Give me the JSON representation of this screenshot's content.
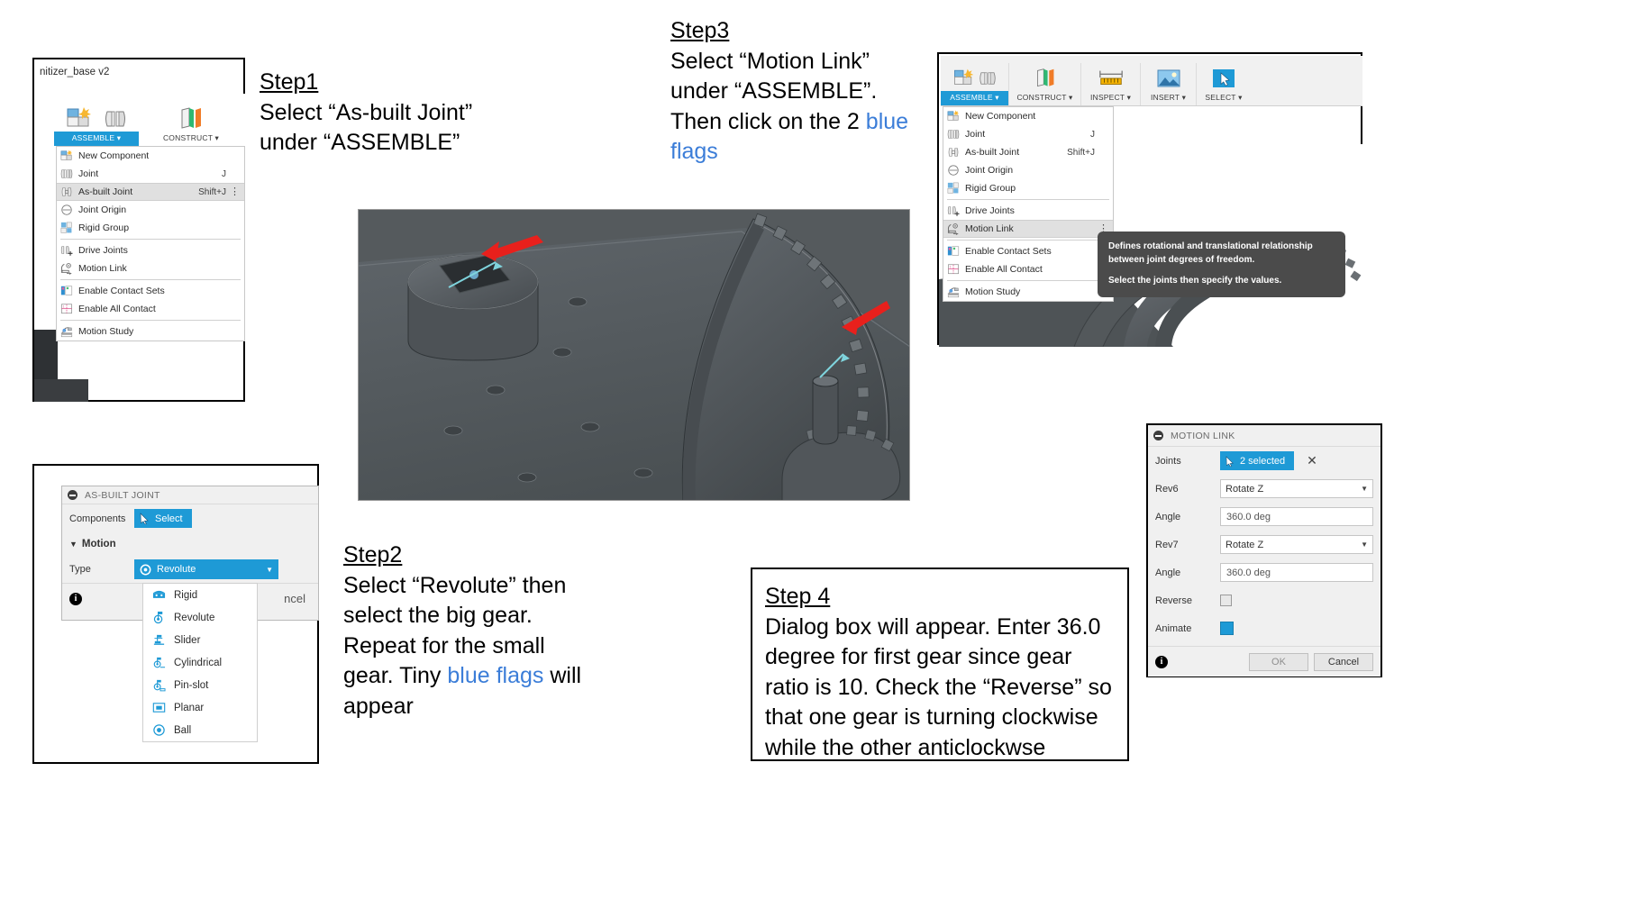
{
  "steps": {
    "step1": {
      "title": "Step1",
      "lines": [
        "Select “As-built Joint”",
        "under “ASSEMBLE”"
      ]
    },
    "step2": {
      "title": "Step2",
      "line1": "Select “Revolute” then",
      "line2": "select the big gear.",
      "line3": "Repeat for the small",
      "line4a": "gear. Tiny ",
      "line4b": "blue flags",
      "line4c": " will",
      "line5": "appear"
    },
    "step3": {
      "title": "Step3",
      "line1": "Select “Motion Link”",
      "line2": "under “ASSEMBLE”.",
      "line3a": "Then click on the 2 ",
      "line3b": "blue",
      "line4": "flags"
    },
    "step4": {
      "title": "Step 4",
      "body": "Dialog box will appear. Enter 36.0 degree for first gear since gear ratio is 10. Check the “Reverse” so that one gear is turning clockwise while the other anticlockwse"
    }
  },
  "panel1": {
    "document_title": "nitizer_base v2",
    "ribbon": [
      {
        "label": "ASSEMBLE ▾",
        "icon": "new-component-icon",
        "active": true
      },
      {
        "label": "",
        "icon": "joint-icon",
        "active": false
      },
      {
        "label": "CONSTRUCT ▾",
        "icon": "construct-icon",
        "active": false
      }
    ],
    "menu": [
      {
        "label": "New Component",
        "shortcut": "",
        "icon": "new-component-icon",
        "highlighted": false,
        "sep_after": false
      },
      {
        "label": "Joint",
        "shortcut": "J",
        "icon": "joint-icon",
        "highlighted": false,
        "sep_after": false
      },
      {
        "label": "As-built Joint",
        "shortcut": "Shift+J",
        "icon": "as-built-joint-icon",
        "highlighted": true,
        "overflow": true,
        "sep_after": false
      },
      {
        "label": "Joint Origin",
        "shortcut": "",
        "icon": "joint-origin-icon",
        "highlighted": false,
        "sep_after": false
      },
      {
        "label": "Rigid Group",
        "shortcut": "",
        "icon": "rigid-group-icon",
        "highlighted": false,
        "sep_after": true
      },
      {
        "label": "Drive Joints",
        "shortcut": "",
        "icon": "drive-joints-icon",
        "highlighted": false,
        "sep_after": false
      },
      {
        "label": "Motion Link",
        "shortcut": "",
        "icon": "motion-link-icon",
        "highlighted": false,
        "sep_after": true
      },
      {
        "label": "Enable Contact Sets",
        "shortcut": "",
        "icon": "enable-contact-sets-icon",
        "highlighted": false,
        "sep_after": false
      },
      {
        "label": "Enable All Contact",
        "shortcut": "",
        "icon": "enable-all-contact-icon",
        "highlighted": false,
        "sep_after": true
      },
      {
        "label": "Motion Study",
        "shortcut": "",
        "icon": "motion-study-icon",
        "highlighted": false,
        "sep_after": false
      }
    ]
  },
  "panel3": {
    "ribbon": [
      {
        "label": "ASSEMBLE ▾",
        "icon": "new-component-icon",
        "active": true
      },
      {
        "label": "",
        "icon": "joint-icon",
        "active": false
      },
      {
        "label": "CONSTRUCT ▾",
        "icon": "construct-icon",
        "active": false
      },
      {
        "label": "INSPECT ▾",
        "icon": "inspect-icon",
        "active": false
      },
      {
        "label": "INSERT ▾",
        "icon": "insert-icon",
        "active": false
      },
      {
        "label": "SELECT ▾",
        "icon": "select-icon",
        "active": false
      }
    ],
    "menu": [
      {
        "label": "New Component",
        "shortcut": "",
        "icon": "new-component-icon",
        "highlighted": false,
        "sep_after": false
      },
      {
        "label": "Joint",
        "shortcut": "J",
        "icon": "joint-icon",
        "highlighted": false,
        "sep_after": false
      },
      {
        "label": "As-built Joint",
        "shortcut": "Shift+J",
        "icon": "as-built-joint-icon",
        "highlighted": false,
        "sep_after": false
      },
      {
        "label": "Joint Origin",
        "shortcut": "",
        "icon": "joint-origin-icon",
        "highlighted": false,
        "sep_after": false
      },
      {
        "label": "Rigid Group",
        "shortcut": "",
        "icon": "rigid-group-icon",
        "highlighted": false,
        "sep_after": true
      },
      {
        "label": "Drive Joints",
        "shortcut": "",
        "icon": "drive-joints-icon",
        "highlighted": false,
        "sep_after": false
      },
      {
        "label": "Motion Link",
        "shortcut": "",
        "icon": "motion-link-icon",
        "highlighted": true,
        "overflow": true,
        "sep_after": true
      },
      {
        "label": "Enable Contact Sets",
        "shortcut": "",
        "icon": "enable-contact-sets-icon",
        "highlighted": false,
        "sep_after": false
      },
      {
        "label": "Enable All Contact",
        "shortcut": "",
        "icon": "enable-all-contact-icon",
        "highlighted": false,
        "sep_after": true
      },
      {
        "label": "Motion Study",
        "shortcut": "",
        "icon": "motion-study-icon",
        "highlighted": false,
        "sep_after": false
      }
    ],
    "tooltip": {
      "line1": "Defines rotational and translational relationship between joint degrees of freedom.",
      "line2": "Select the joints then specify the values."
    }
  },
  "asbuilt_dialog": {
    "title": "AS-BUILT JOINT",
    "components_label": "Components",
    "select_button": "Select",
    "motion_section": "Motion",
    "type_label": "Type",
    "type_value": "Revolute",
    "cancel_label": "ncel",
    "type_options": [
      {
        "label": "Rigid",
        "icon": "rigid-icon"
      },
      {
        "label": "Revolute",
        "icon": "revolute-icon"
      },
      {
        "label": "Slider",
        "icon": "slider-icon"
      },
      {
        "label": "Cylindrical",
        "icon": "cylindrical-icon"
      },
      {
        "label": "Pin-slot",
        "icon": "pin-slot-icon"
      },
      {
        "label": "Planar",
        "icon": "planar-icon"
      },
      {
        "label": "Ball",
        "icon": "ball-icon"
      }
    ]
  },
  "motionlink_dialog": {
    "title": "MOTION LINK",
    "rows": [
      {
        "key": "Joints",
        "type": "selected",
        "value": "2 selected"
      },
      {
        "key": "Rev6",
        "type": "combo",
        "value": "Rotate Z"
      },
      {
        "key": "Angle",
        "type": "text",
        "value": "360.0 deg"
      },
      {
        "key": "Rev7",
        "type": "combo",
        "value": "Rotate Z"
      },
      {
        "key": "Angle",
        "type": "text",
        "value": "360.0 deg"
      },
      {
        "key": "Reverse",
        "type": "checkbox",
        "value": ""
      },
      {
        "key": "Animate",
        "type": "checkbox-filled",
        "value": ""
      }
    ],
    "ok_label": "OK",
    "cancel_label": "Cancel"
  },
  "colors": {
    "accent": "#1e9ad6",
    "blue_text": "#3b7dd8",
    "arrow_red": "#e8201c",
    "viewport_bg": "#555a5d"
  }
}
